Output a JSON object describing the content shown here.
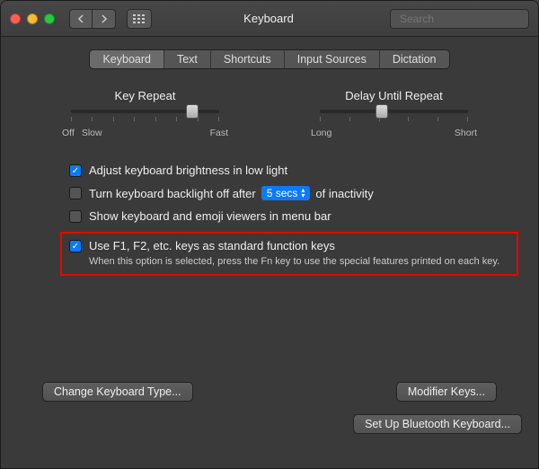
{
  "window": {
    "title": "Keyboard"
  },
  "search": {
    "placeholder": "Search"
  },
  "tabs": [
    "Keyboard",
    "Text",
    "Shortcuts",
    "Input Sources",
    "Dictation"
  ],
  "active_tab_index": 0,
  "sliders": {
    "key_repeat": {
      "title": "Key Repeat",
      "left_labels": [
        "Off",
        "Slow"
      ],
      "right_label": "Fast",
      "position_pct": 82,
      "ticks": 8
    },
    "delay": {
      "title": "Delay Until Repeat",
      "left_labels": [
        "Long"
      ],
      "right_label": "Short",
      "position_pct": 42,
      "ticks": 6
    }
  },
  "options": {
    "brightness": {
      "checked": true,
      "label": "Adjust keyboard brightness in low light"
    },
    "backlight_off": {
      "checked": false,
      "label_before": "Turn keyboard backlight off after",
      "select_value": "5 secs",
      "label_after": "of inactivity"
    },
    "emoji_viewer": {
      "checked": false,
      "label": "Show keyboard and emoji viewers in menu bar"
    },
    "fn_keys": {
      "checked": true,
      "label": "Use F1, F2, etc. keys as standard function keys",
      "hint": "When this option is selected, press the Fn key to use the special features printed on each key."
    }
  },
  "buttons": {
    "change_type": "Change Keyboard Type...",
    "modifier": "Modifier Keys...",
    "bluetooth": "Set Up Bluetooth Keyboard..."
  }
}
